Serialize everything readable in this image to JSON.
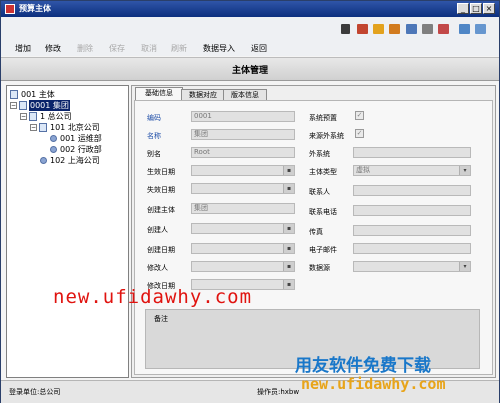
{
  "window": {
    "title": "预算主体"
  },
  "menu": {
    "items": [
      {
        "label": "增加",
        "enabled": true
      },
      {
        "label": "修改",
        "enabled": true
      },
      {
        "label": "删除",
        "enabled": false
      },
      {
        "label": "保存",
        "enabled": false
      },
      {
        "label": "取消",
        "enabled": false
      },
      {
        "label": "刷新",
        "enabled": false
      },
      {
        "label": "数据导入",
        "enabled": true
      },
      {
        "label": "返回",
        "enabled": true
      }
    ]
  },
  "page_title": "主体管理",
  "tree": {
    "nodes": [
      {
        "label": "001 主体"
      },
      {
        "label": "0001 集团",
        "selected": true
      },
      {
        "label": "1 总公司"
      },
      {
        "label": "101 北京公司"
      },
      {
        "label": "001 运维部"
      },
      {
        "label": "002 行政部"
      },
      {
        "label": "102 上海公司"
      }
    ]
  },
  "tabs": [
    {
      "label": "基础信息",
      "active": true
    },
    {
      "label": "数据对应"
    },
    {
      "label": "版本信息"
    }
  ],
  "form": {
    "code_label": "编码",
    "code_value": "0001",
    "name_label": "名称",
    "name_value": "集团",
    "alias_label": "别名",
    "alias_value": "Root",
    "effective_label": "生效日期",
    "expire_label": "失效日期",
    "creator_entity_label": "创建主体",
    "creator_entity_value": "集团",
    "creator_label": "创建人",
    "create_date_label": "创建日期",
    "modifier_label": "修改人",
    "modify_date_label": "修改日期",
    "system_preset_label": "系统预置",
    "external_source_label": "来源外系统",
    "external_system_label": "外系统",
    "entity_type_label": "主体类型",
    "entity_type_value": "虚拟",
    "contact_label": "联系人",
    "phone_label": "联系电话",
    "fax_label": "传真",
    "email_label": "电子邮件",
    "datasource_label": "数据源",
    "remark_label": "备注"
  },
  "status": {
    "login_unit": "登录单位:总公司",
    "operator": "操作员:hxbw"
  },
  "watermarks": {
    "site_red": "new.ufidawhy.com",
    "slogan_blue": "用友软件免费下载",
    "site_orange": "new.ufidawhy.com"
  },
  "colors": {
    "title_bar": "#0c2f7e",
    "label_blue": "#1f4ea8",
    "selection": "#0a246a"
  }
}
